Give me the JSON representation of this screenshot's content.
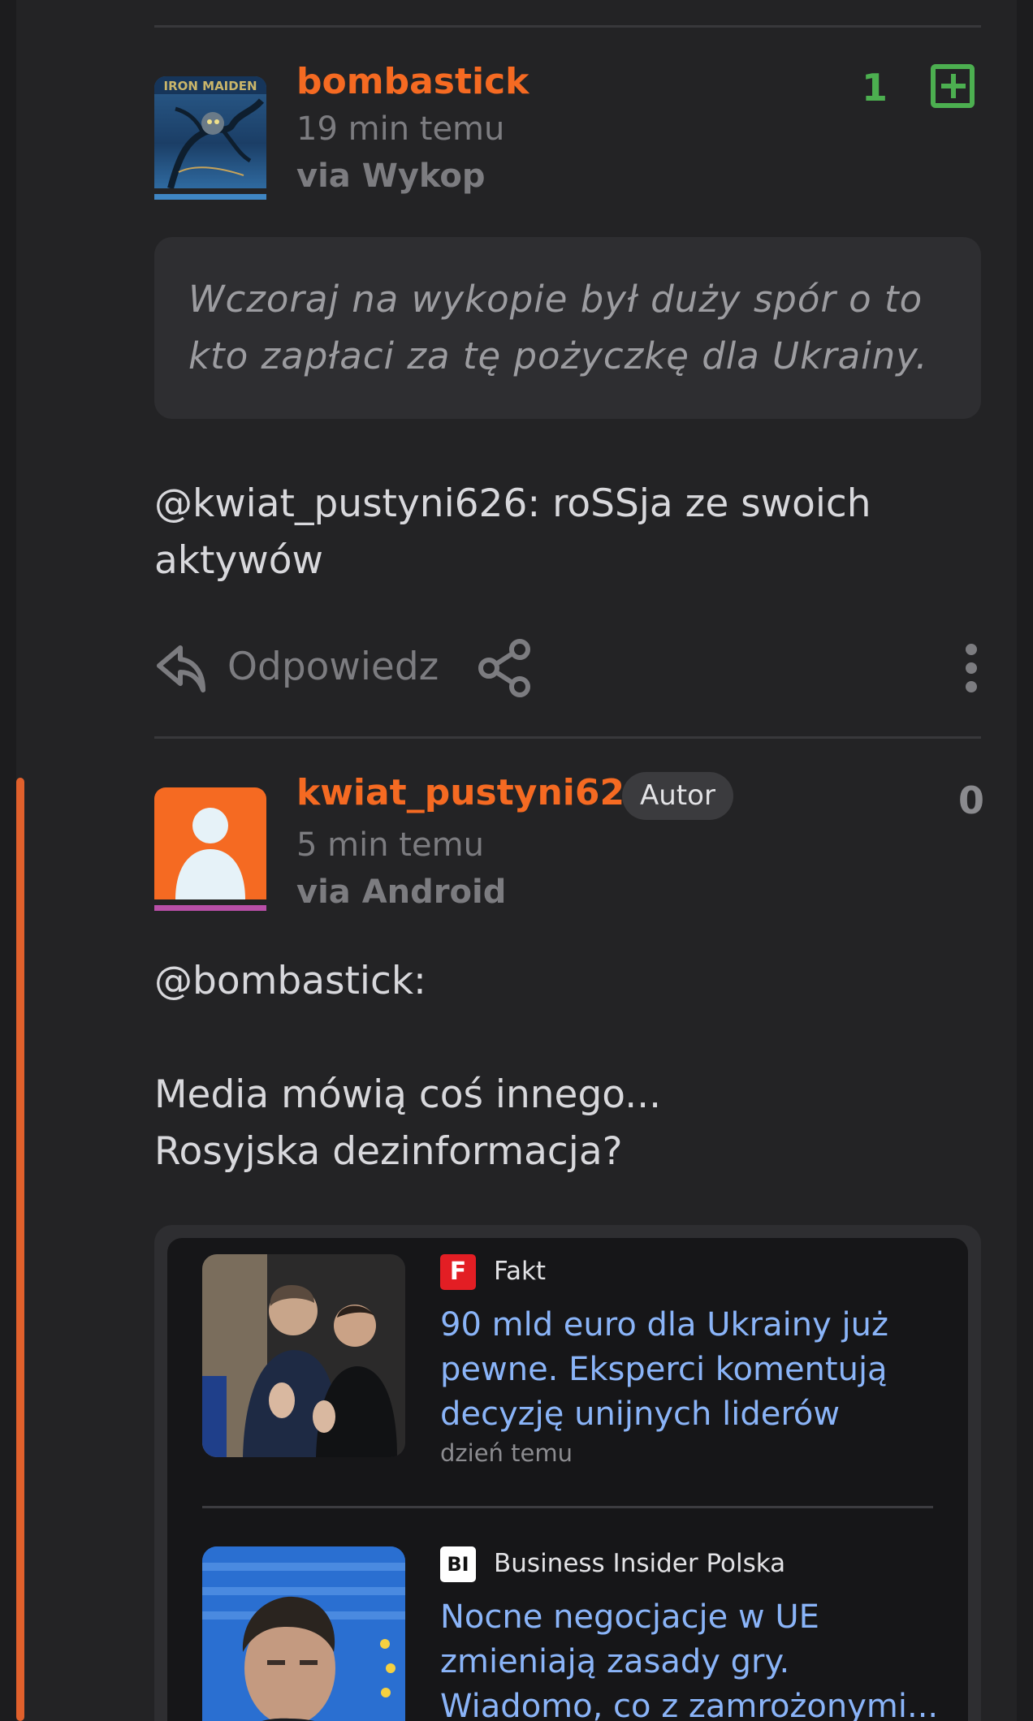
{
  "comments": [
    {
      "username": "bombastick",
      "time": "19 min temu",
      "via": "via Wykop",
      "votes": "1",
      "avatar": "iron-maiden-album-cover",
      "quote": "Wczoraj na wykopie był duży spór o to kto zapłaci za tę pożyczkę dla Ukrainy.",
      "mention": "@kwiat_pustyni626",
      "text": ": roSSja ze swoich aktywów",
      "reply_label": "Odpowiedz"
    },
    {
      "username": "kwiat_pustyni626",
      "badge": "Autor",
      "time": "5 min temu",
      "via": "via Android",
      "votes": "0",
      "avatar": "default-user-avatar",
      "mention": "@bombastick:",
      "line1": "Media mówią coś innego...",
      "line2": "Rosyjska dezinformacja?"
    }
  ],
  "embed": {
    "items": [
      {
        "source": "Fakt",
        "source_logo": "F",
        "title": "90 mld euro dla Ukrainy już pewne. Eksperci komentują decyzję unijnych liderów",
        "time": "dzień temu"
      },
      {
        "source": "Business Insider Polska",
        "source_logo": "BI",
        "title": "Nocne negocjacje w UE zmieniają zasady gry. Wiadomo, co z zamrożonymi..."
      }
    ]
  },
  "colors": {
    "accent": "#f56a22",
    "thread": "#e0602c",
    "vote_positive": "#4caf50",
    "link": "#8ab4f8"
  },
  "icons": [
    "reply-icon",
    "share-icon",
    "more-options-icon",
    "plus-vote-icon"
  ]
}
